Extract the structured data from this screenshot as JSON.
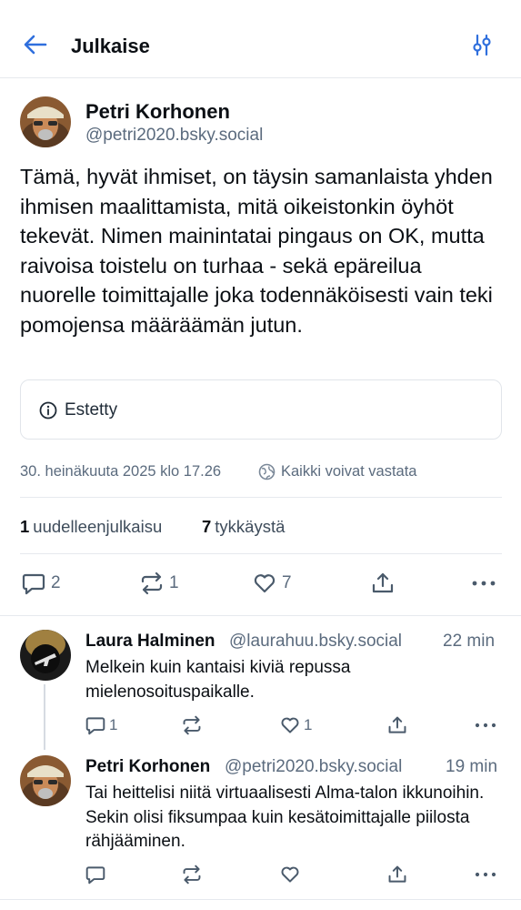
{
  "header": {
    "title": "Julkaise",
    "back_icon": "arrow-left-icon",
    "filter_icon": "sliders-icon"
  },
  "post": {
    "author_name": "Petri Korhonen",
    "author_handle": "@petri2020.bsky.social",
    "text": "Tämä, hyvät ihmiset, on täysin samanlaista yhden ihmisen maalittamista, mitä oikeistonkin öyhöt tekevät. Nimen mainintatai pingaus on OK, mutta raivoisa toistelu on turhaa  - sekä epäreilua nuorelle toimittajalle joka todennäköisesti vain teki pomojensa määräämän jutun.",
    "blocked_label": "Estetty",
    "timestamp": "30. heinäkuuta 2025 klo 17.26",
    "reply_setting": "Kaikki voivat vastata",
    "reposts_count": "1",
    "reposts_label": "uudelleenjulkaisu",
    "likes_count": "7",
    "likes_label": "tykkäystä",
    "actions": {
      "reply_count": "2",
      "repost_count": "1",
      "like_count": "7"
    }
  },
  "replies": [
    {
      "author_name": "Laura Halminen",
      "author_handle": "@laurahuu.bsky.social",
      "time": "22 min",
      "text": "Melkein kuin kantaisi kiviä repussa mielenosoituspaikalle.",
      "reply_count": "1",
      "repost_count": "",
      "like_count": "1"
    },
    {
      "author_name": "Petri Korhonen",
      "author_handle": "@petri2020.bsky.social",
      "time": "19 min",
      "text": "Tai heittelisi niitä virtuaalisesti Alma-talon ikkunoihin. Sekin olisi fiksumpaa kuin kesätoimittajalle piilosta rähjääminen.",
      "reply_count": "",
      "repost_count": "",
      "like_count": ""
    }
  ],
  "colors": {
    "text": "#0b0f14",
    "muted": "#5b6b7e",
    "border": "#e6e9ee",
    "icon": "#4a5a6b"
  }
}
